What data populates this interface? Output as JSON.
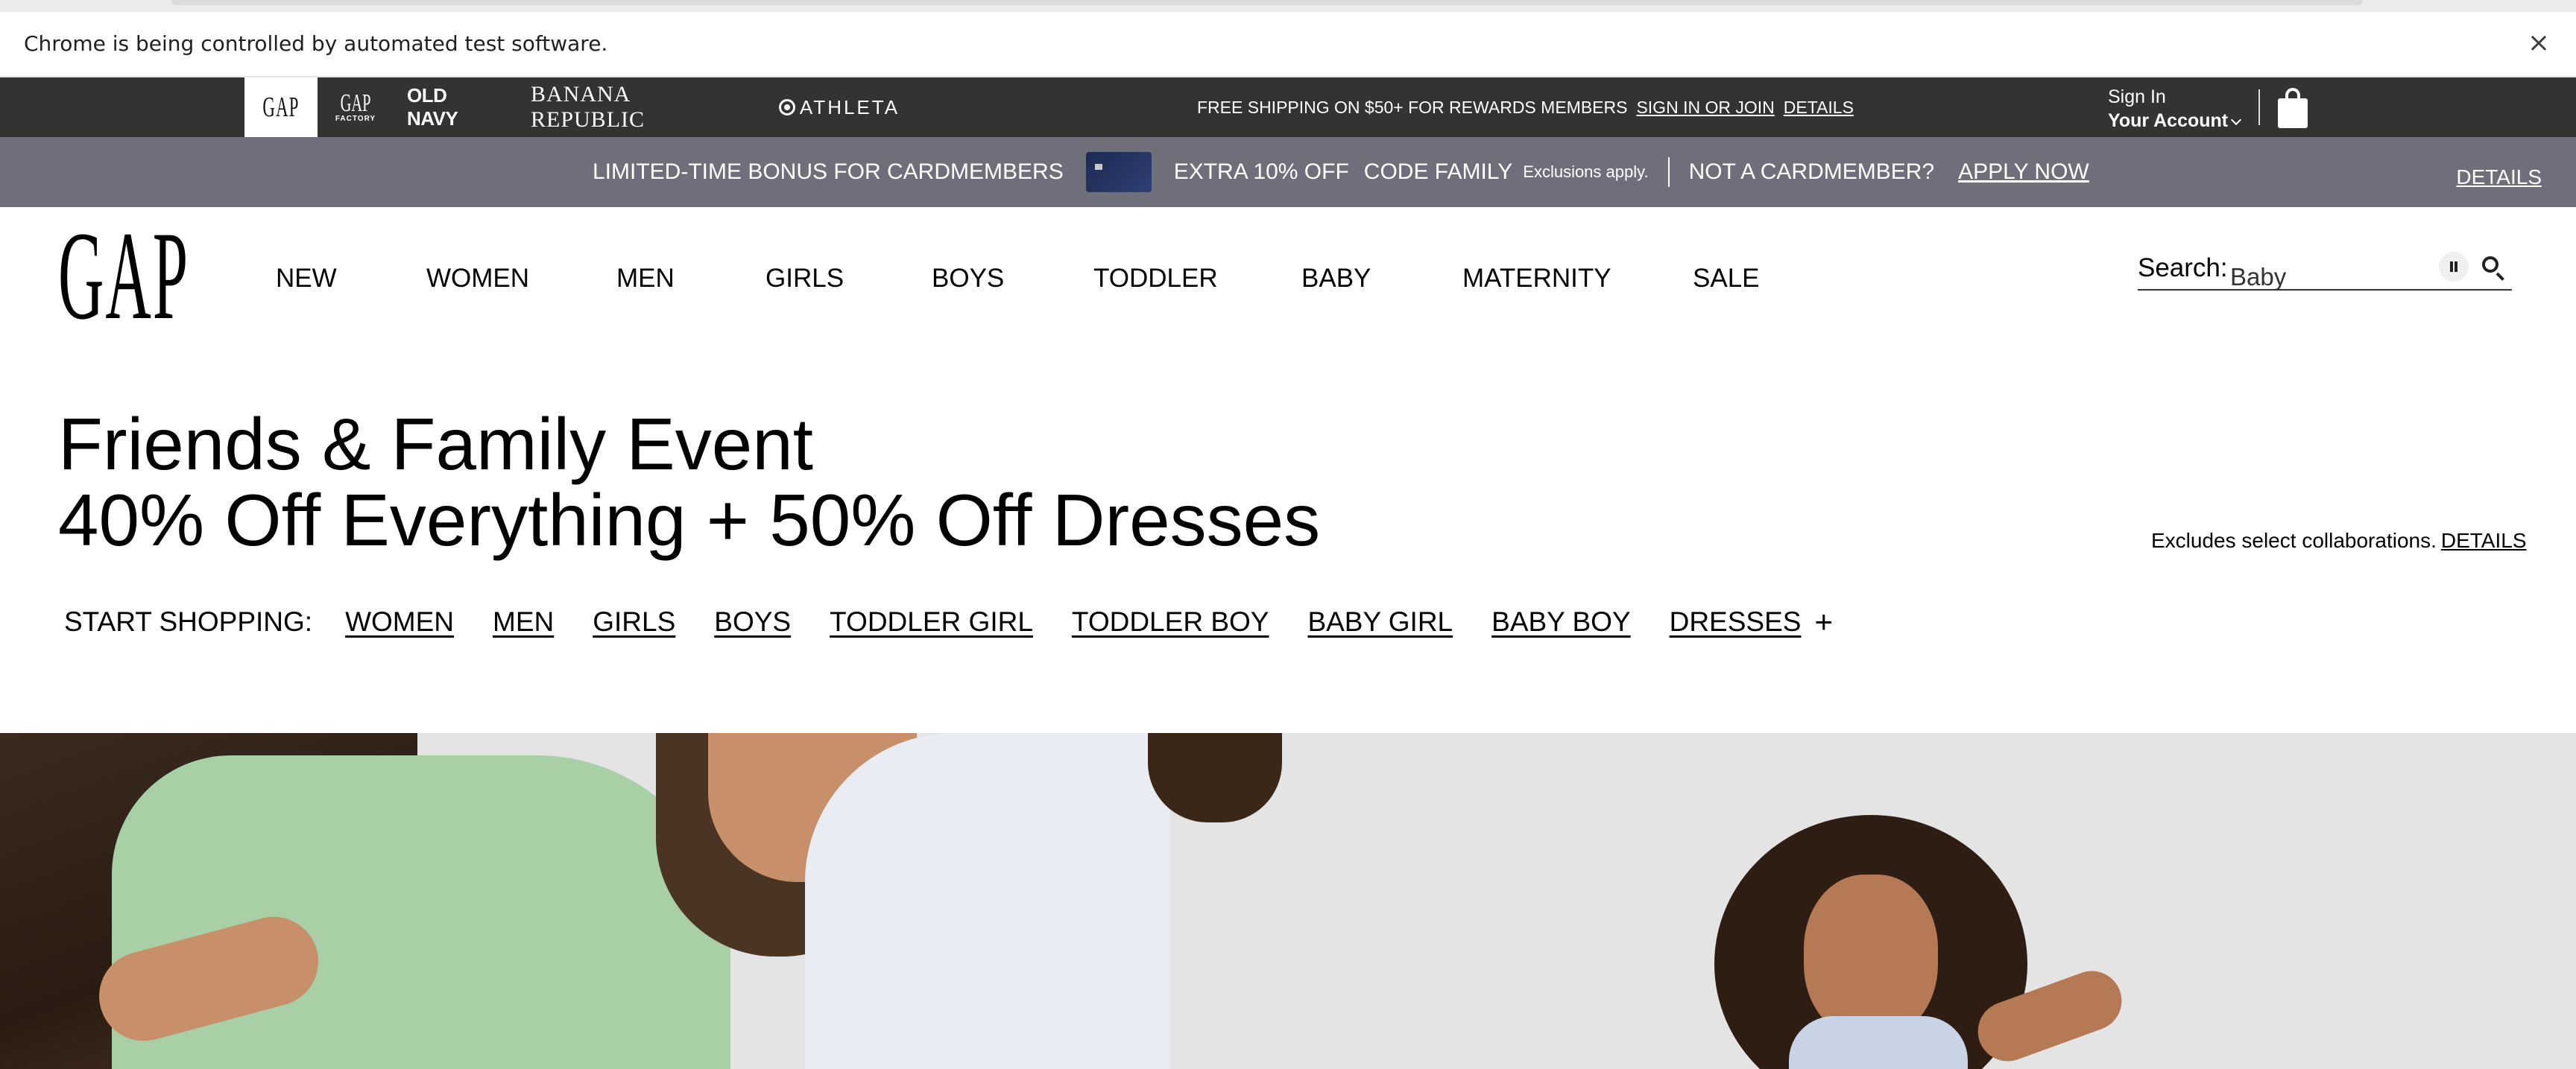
{
  "infobar": {
    "message": "Chrome is being controlled by automated test software.",
    "close_icon": "×"
  },
  "brands": {
    "gap": "GAP",
    "gap_factory_top": "GAP",
    "gap_factory_bottom": "FACTORY",
    "old_navy": "OLD NAVY",
    "banana_republic": "BANANA REPUBLIC",
    "athleta": "ATHLETA"
  },
  "shipping": {
    "message": "FREE SHIPPING ON $50+ FOR REWARDS MEMBERS",
    "sign_in_link": "SIGN IN OR JOIN",
    "details_link": "DETAILS"
  },
  "account": {
    "line1": "Sign In",
    "line2": "Your Account"
  },
  "promo": {
    "bonus": "LIMITED-TIME BONUS FOR CARDMEMBERS",
    "offer": "EXTRA 10% OFF",
    "code": "CODE FAMILY",
    "exclusions": "Exclusions apply.",
    "not_member": "NOT A CARDMEMBER?",
    "apply": "APPLY NOW",
    "details": "DETAILS"
  },
  "nav": {
    "logo": "GAP",
    "items": [
      "NEW",
      "WOMEN",
      "MEN",
      "GIRLS",
      "BOYS",
      "TODDLER",
      "BABY",
      "MATERNITY",
      "SALE"
    ]
  },
  "search": {
    "label": "Search:",
    "value": "Baby"
  },
  "hero": {
    "title_line1": "Friends & Family Event",
    "title_line2": "40% Off Everything + 50% Off Dresses",
    "excludes": "Excludes select collaborations.",
    "excludes_link": "DETAILS",
    "shop_label": "START SHOPPING:",
    "shop_links": [
      "WOMEN",
      "MEN",
      "GIRLS",
      "BOYS",
      "TODDLER GIRL",
      "TODDLER BOY",
      "BABY GIRL",
      "BABY BOY",
      "DRESSES"
    ],
    "plus": "+"
  },
  "colors": {
    "brand_bar": "#333333",
    "promo_bar": "#6e6f7a",
    "hero_bg": "#e4e4e4"
  }
}
